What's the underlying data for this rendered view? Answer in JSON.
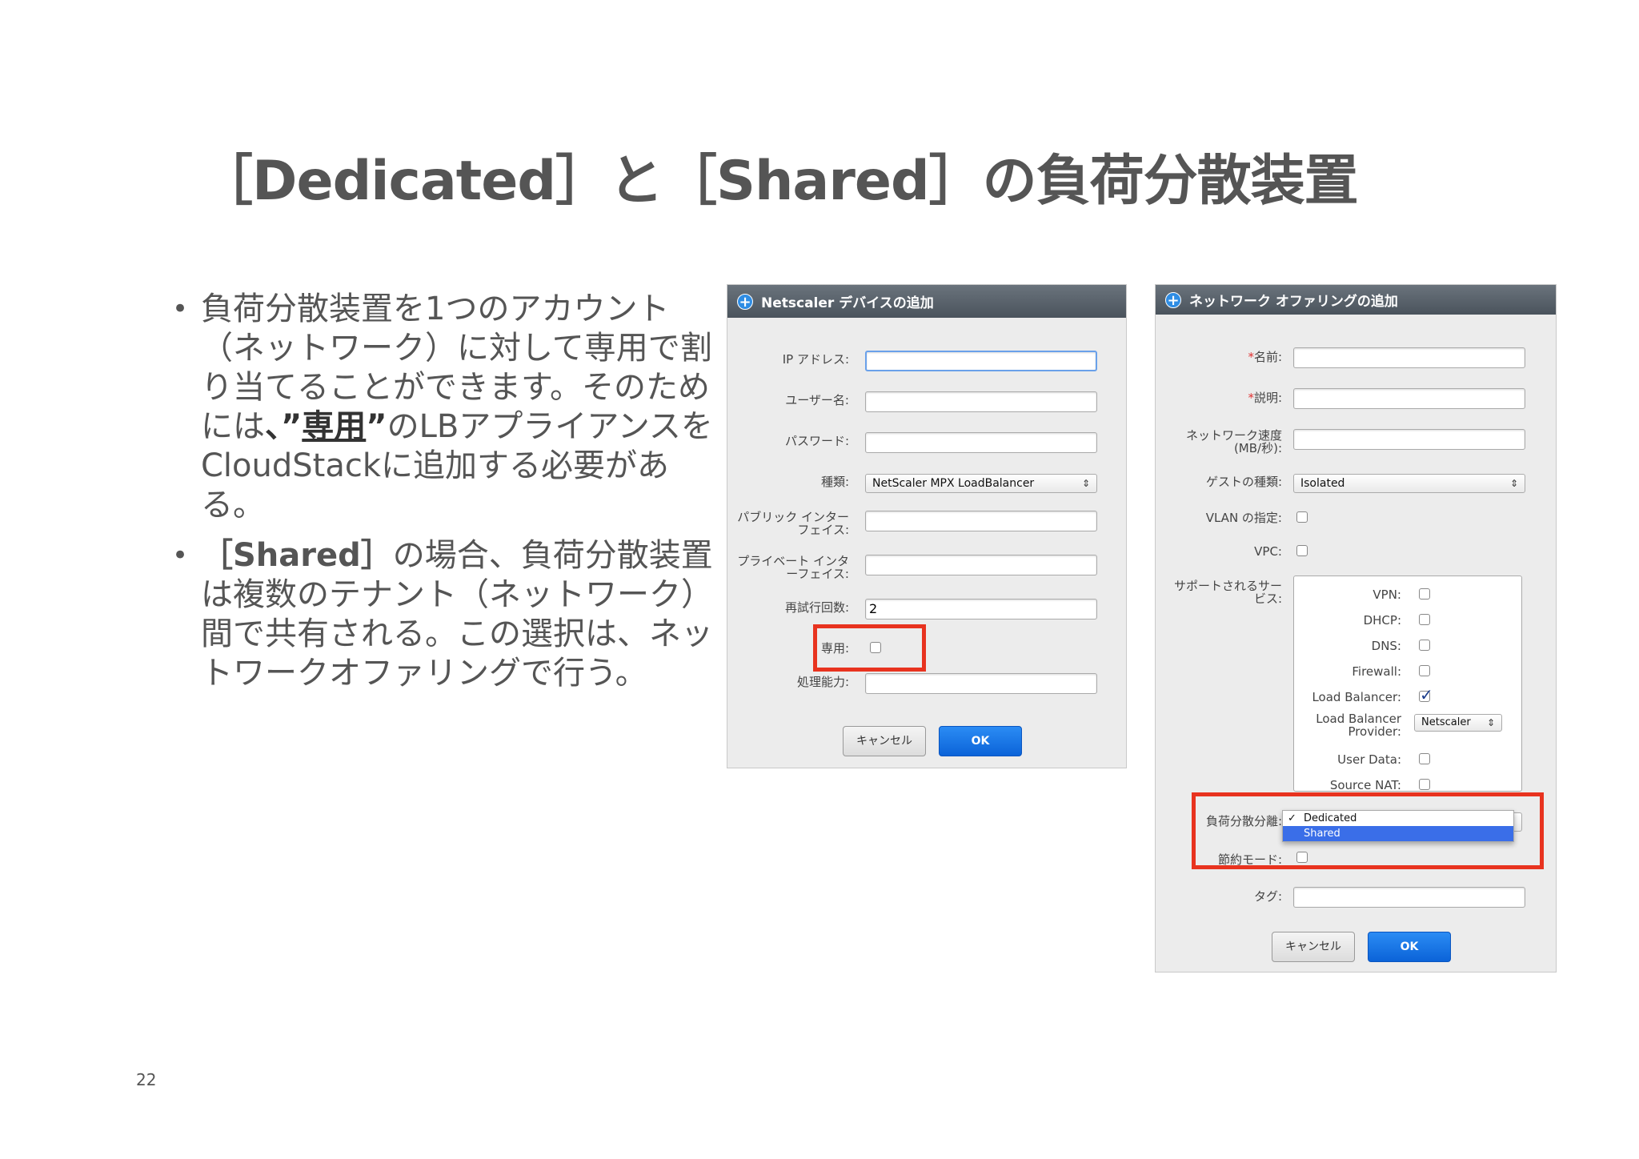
{
  "slide": {
    "title": "［Dedicated］と［Shared］の負荷分散装置",
    "page_number": "22",
    "bullets": [
      {
        "dot": "•",
        "part1": "負荷分散装置を1つのアカウント（ネットワーク）に対して専用で割り当てることができます。そのためには",
        "part2": "、”",
        "part3": "専用",
        "part4": "”",
        "part5": "のLBアプライアンスをCloudStackに追加する必要がある。"
      },
      {
        "dot": "•",
        "part1": "［Shared］",
        "part2": "の場合、負荷分散装置は複数のテナント（ネットワーク）間で共有される。この選択は、ネットワークオファリングで行う。"
      }
    ]
  },
  "dialog1": {
    "title": "Netscaler デバイスの追加",
    "fields": {
      "ip": "IP アドレス:",
      "user": "ユーザー名:",
      "password": "パスワード:",
      "type": "種類:",
      "type_value": "NetScaler MPX LoadBalancer",
      "public_if_1": "パブリック インター",
      "public_if_2": "フェイス:",
      "private_if_1": "プライベート インタ",
      "private_if_2": "ーフェイス:",
      "retry": "再試行回数:",
      "retry_value": "2",
      "dedicated": "専用:",
      "capacity": "処理能力:"
    },
    "cancel": "キャンセル",
    "ok": "OK"
  },
  "dialog2": {
    "title": "ネットワーク オファリングの追加",
    "fields": {
      "req_mark": "*",
      "name": "名前:",
      "desc": "説明:",
      "speed_1": "ネットワーク速度",
      "speed_2": "(MB/秒):",
      "guest_type": "ゲストの種類:",
      "guest_value": "Isolated",
      "vlan": "VLAN の指定:",
      "vpc": "VPC:",
      "services_1": "サポートされるサー",
      "services_2": "ビス:",
      "lb_isolation": "負荷分散分離:",
      "conserve": "節約モード:",
      "tags": "タグ:"
    },
    "services": {
      "vpn": "VPN:",
      "dhcp": "DHCP:",
      "dns": "DNS:",
      "firewall": "Firewall:",
      "lb": "Load Balancer:",
      "lb_provider_1": "Load Balancer",
      "lb_provider_2": "Provider:",
      "lb_provider_value": "Netscaler",
      "userdata": "User Data:",
      "snat": "Source NAT:"
    },
    "dropdown": {
      "check": "✓",
      "options": [
        "Dedicated",
        "Shared"
      ]
    },
    "cancel": "キャンセル",
    "ok": "OK"
  },
  "icons": {
    "plus": "+",
    "updown": "⇕",
    "checkmark": "✓"
  },
  "colors": {
    "highlight": "#e8331f",
    "ok_button": "#0b63d8",
    "header": "#4a535c"
  }
}
